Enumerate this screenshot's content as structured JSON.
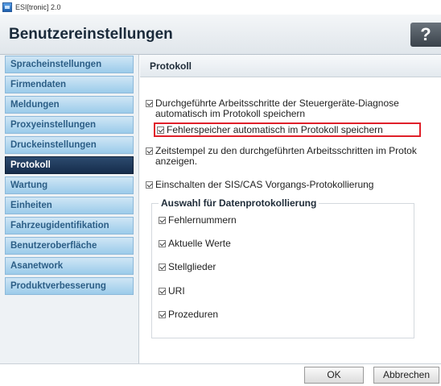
{
  "window": {
    "title": "ESI[tronic] 2.0"
  },
  "header": {
    "title": "Benutzereinstellungen",
    "help_label": "?"
  },
  "sidebar": {
    "items": [
      {
        "label": "Spracheinstellungen",
        "active": false
      },
      {
        "label": "Firmendaten",
        "active": false
      },
      {
        "label": "Meldungen",
        "active": false
      },
      {
        "label": "Proxyeinstellungen",
        "active": false
      },
      {
        "label": "Druckeinstellungen",
        "active": false
      },
      {
        "label": "Protokoll",
        "active": true
      },
      {
        "label": "Wartung",
        "active": false
      },
      {
        "label": "Einheiten",
        "active": false
      },
      {
        "label": "Fahrzeugidentifikation",
        "active": false
      },
      {
        "label": "Benutzeroberfläche",
        "active": false
      },
      {
        "label": "Asanetwork",
        "active": false
      },
      {
        "label": "Produktverbesserung",
        "active": false
      }
    ]
  },
  "content": {
    "title": "Protokoll",
    "options": [
      {
        "line1": "Durchgeführte Arbeitsschritte der Steuergeräte-Diagnose",
        "line2": "automatisch im Protokoll speichern",
        "checked": true
      },
      {
        "line1": "Fehlerspeicher automatisch im Protokoll speichern",
        "checked": true,
        "highlighted": true
      },
      {
        "line1": "Zeitstempel zu den durchgeführten Arbeitsschritten im Protok",
        "line2": "anzeigen.",
        "checked": true
      },
      {
        "line1": "Einschalten der SIS/CAS Vorgangs-Protokollierung",
        "checked": true
      }
    ],
    "group": {
      "title": "Auswahl für Datenprotokollierung",
      "items": [
        {
          "label": "Fehlernummern",
          "checked": true
        },
        {
          "label": "Aktuelle Werte",
          "checked": true
        },
        {
          "label": "Stellglieder",
          "checked": true
        },
        {
          "label": "URI",
          "checked": true
        },
        {
          "label": "Prozeduren",
          "checked": true
        }
      ]
    }
  },
  "footer": {
    "ok_label": "OK",
    "cancel_label": "Abbrechen"
  },
  "colors": {
    "highlight": "#e0202a",
    "active_nav": "#1c3556",
    "nav_item": "#b8dcf2"
  }
}
